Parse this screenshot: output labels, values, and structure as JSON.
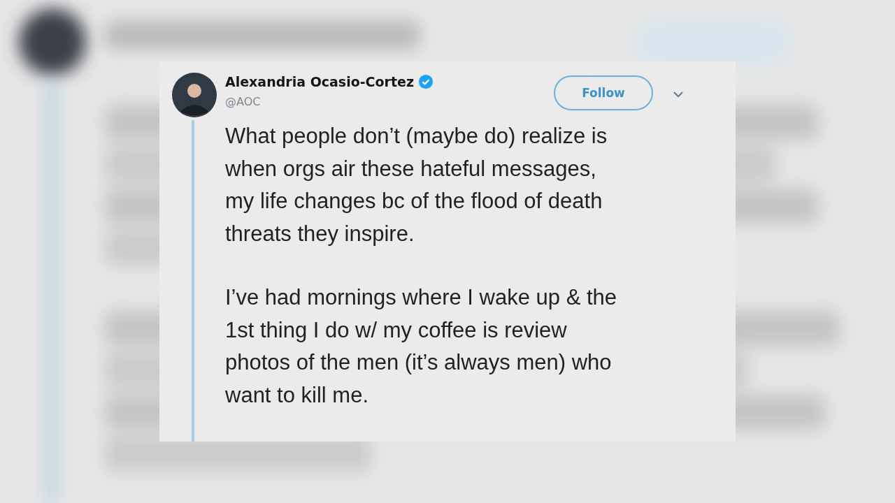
{
  "tweet": {
    "name": "Alexandria Ocasio-Cortez",
    "verified": true,
    "handle": "@AOC",
    "follow_button": "Follow",
    "paragraphs": [
      [
        "What people don’t (maybe do) realize is",
        "when orgs air these hateful messages,",
        "my life changes bc of the flood of death",
        "threats they inspire."
      ],
      [
        "I’ve had mornings where I wake up & the",
        "1st thing I do w/ my coffee is review",
        "photos of the men (it’s always men) who",
        "want to kill me."
      ]
    ]
  }
}
